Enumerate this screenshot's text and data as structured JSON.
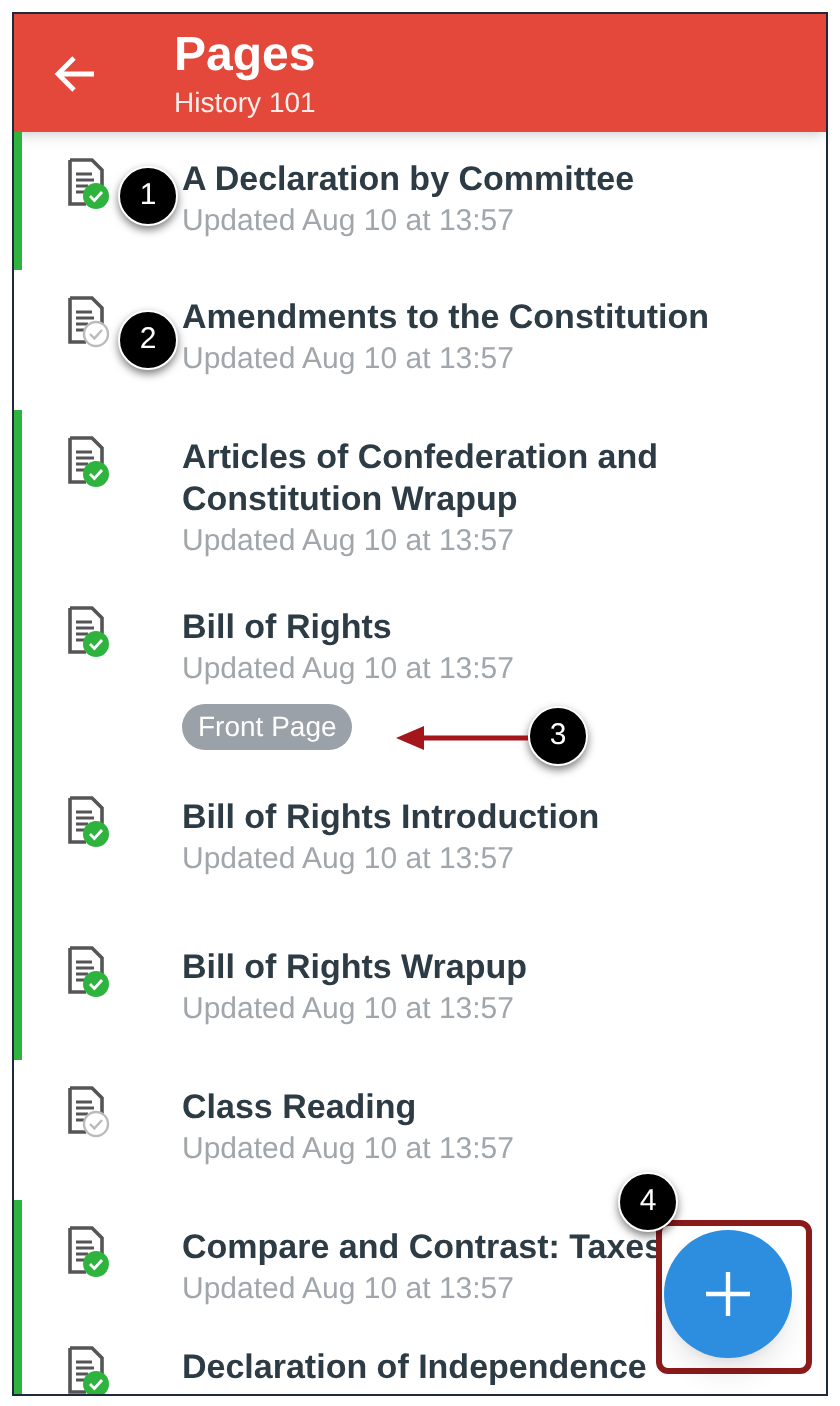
{
  "header": {
    "title": "Pages",
    "subtitle": "History 101"
  },
  "pages": [
    {
      "title": "A Declaration by Committee",
      "updated": "Updated Aug 10 at 13:57",
      "published": true
    },
    {
      "title": "Amendments to the Constitution",
      "updated": "Updated Aug 10 at 13:57",
      "published": false
    },
    {
      "title": "Articles of Confederation and Constitution Wrapup",
      "updated": "Updated Aug 10 at 13:57",
      "published": true
    },
    {
      "title": "Bill of Rights",
      "updated": "Updated Aug 10 at 13:57",
      "published": true,
      "badge": "Front Page"
    },
    {
      "title": "Bill of Rights Introduction",
      "updated": "Updated Aug 10 at 13:57",
      "published": true
    },
    {
      "title": "Bill of Rights Wrapup",
      "updated": "Updated Aug 10 at 13:57",
      "published": true
    },
    {
      "title": "Class Reading",
      "updated": "Updated Aug 10 at 13:57",
      "published": false
    },
    {
      "title": "Compare and Contrast: Taxes",
      "updated": "Updated Aug 10 at 13:57",
      "published": true
    },
    {
      "title": "Declaration of Independence",
      "published": true
    }
  ],
  "callouts": [
    "1",
    "2",
    "3",
    "4"
  ]
}
